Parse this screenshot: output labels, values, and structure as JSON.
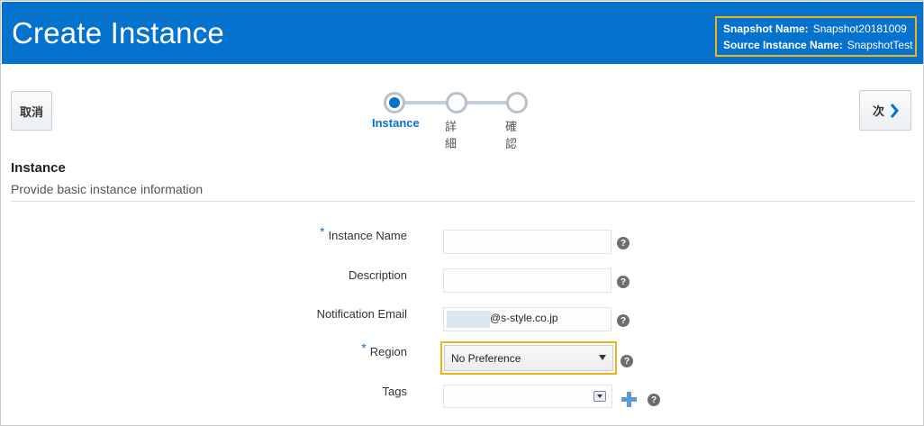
{
  "header": {
    "title": "Create Instance",
    "snapshot_name_label": "Snapshot Name:",
    "snapshot_name_value": "Snapshot20181009",
    "source_instance_label": "Source Instance Name:",
    "source_instance_value": "SnapshotTest"
  },
  "train": {
    "cancel_label": "取消",
    "next_label": "次",
    "steps": [
      {
        "label": "Instance",
        "active": true
      },
      {
        "label": "詳細",
        "active": false
      },
      {
        "label": "確認",
        "active": false
      }
    ]
  },
  "section": {
    "title": "Instance",
    "description": "Provide basic instance information"
  },
  "form": {
    "required_marker": "*",
    "instance_name_label": "Instance Name",
    "instance_name_value": "",
    "description_label": "Description",
    "description_value": "",
    "notification_email_label": "Notification Email",
    "notification_email_value": "@s-style.co.jp",
    "region_label": "Region",
    "region_value": "No Preference",
    "tags_label": "Tags",
    "tags_value": "",
    "help_glyph": "?"
  },
  "colors": {
    "header_bg": "#0572ce",
    "highlight": "#f3b312",
    "accent": "#0572ce"
  }
}
